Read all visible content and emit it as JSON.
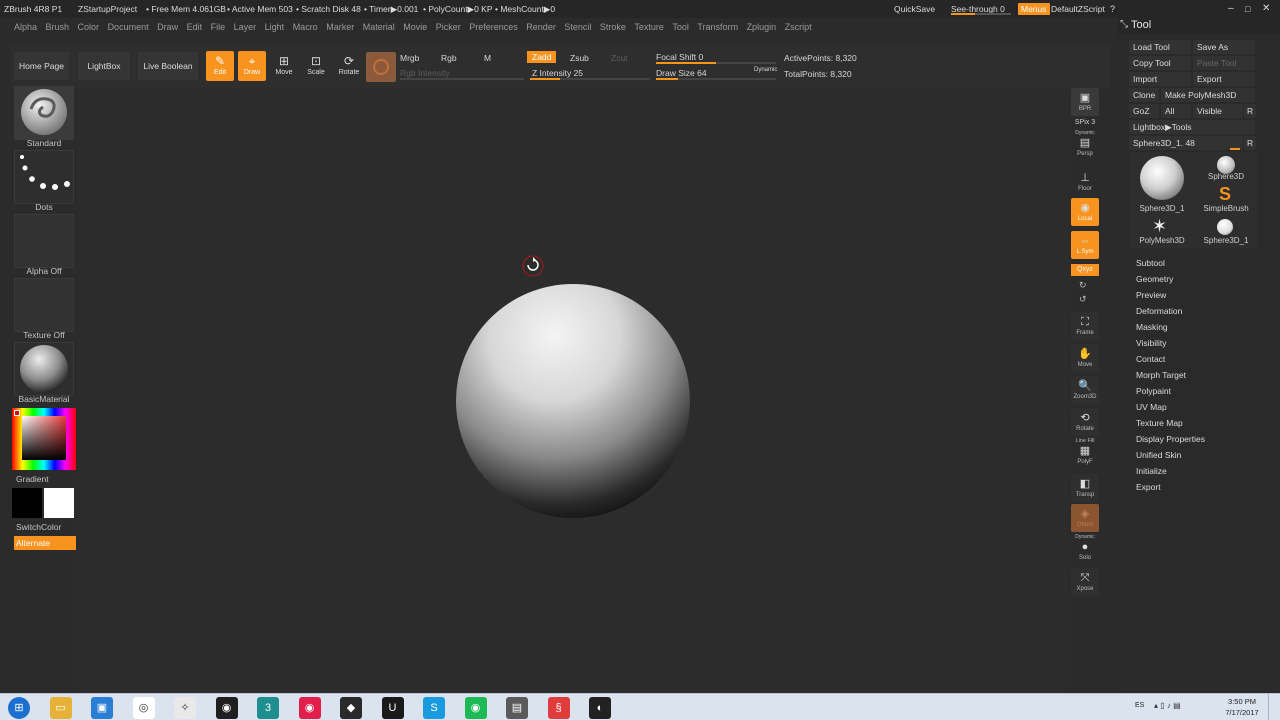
{
  "titlebar": {
    "app": "ZBrush 4R8 P1",
    "project": "ZStartupProject",
    "free_mem": "• Free Mem 4.061GB",
    "active_mem": "• Active Mem 503",
    "scratch": "• Scratch Disk 48",
    "timer": "• Timer▶0.001",
    "polycount": "• PolyCount▶0 KP",
    "meshcount": "• MeshCount▶0",
    "quicksave": "QuickSave",
    "see_through": "See-through  0",
    "menus": "Menus",
    "default_zscript": "DefaultZScript"
  },
  "menubar": [
    "Alpha",
    "Brush",
    "Color",
    "Document",
    "Draw",
    "Edit",
    "File",
    "Layer",
    "Light",
    "Macro",
    "Marker",
    "Material",
    "Movie",
    "Picker",
    "Preferences",
    "Render",
    "Stencil",
    "Stroke",
    "Texture",
    "Tool",
    "Transform",
    "Zplugin",
    "Zscript"
  ],
  "topshelf": {
    "home": "Home Page",
    "lightbox": "LightBox",
    "live_boolean": "Live Boolean",
    "edit": "Edit",
    "draw": "Draw",
    "move": "Move",
    "scale": "Scale",
    "rotate": "Rotate",
    "mrgb": "Mrgb",
    "rgb": "Rgb",
    "m": "M",
    "zadd": "Zadd",
    "zsub": "Zsub",
    "zcut": "Zcut",
    "rgb_intensity": "Rgb Intensity",
    "z_intensity": "Z Intensity 25",
    "focal_shift": "Focal Shift 0",
    "draw_size": "Draw Size 64",
    "dynamic": "Dynamic",
    "active_points": "ActivePoints: 8,320",
    "total_points": "TotalPoints: 8,320",
    "z_intensity_level": 0.25,
    "draw_size_level": 0.18,
    "focal_shift_level": 0.5
  },
  "leftbar": {
    "brush": "Standard",
    "stroke": "Dots",
    "alpha": "Alpha Off",
    "texture": "Texture Off",
    "material": "BasicMaterial",
    "gradient": "Gradient",
    "switchcolor": "SwitchColor",
    "alternate": "Alternate"
  },
  "rightdock": {
    "bpr": "BPR",
    "spix": "SPix 3",
    "dynamic": "Dynamic",
    "persp": "Persp",
    "floor": "Floor",
    "local": "Local",
    "lsym": "L.Sym",
    "xyz": "Qxyz",
    "frame": "Frame",
    "move": "Move",
    "zoom3d": "Zoom3D",
    "rotate": "Rotate",
    "linefill": "Line Fill",
    "polyf": "PolyF",
    "transp": "Transp",
    "ghost": "Ghost",
    "dynamic2": "Dynamic",
    "solo": "Solo",
    "xpose": "Xpose"
  },
  "toolpanel": {
    "title": "Tool",
    "load_tool": "Load Tool",
    "save_as": "Save As",
    "copy_tool": "Copy Tool",
    "paste_tool": "Paste Tool",
    "import": "Import",
    "export": "Export",
    "clone": "Clone",
    "make_polymesh": "Make PolyMesh3D",
    "goz": "GoZ",
    "all": "All",
    "visible": "Visible",
    "r": "R",
    "lightbox_tools": "Lightbox▶Tools",
    "current_tool": "Sphere3D_1. 48",
    "r2": "R",
    "thumbs": [
      "Sphere3D_1",
      "Sphere3D",
      "SimpleBrush",
      "PolyMesh3D",
      "Sphere3D_1"
    ],
    "sections": [
      "Subtool",
      "Geometry",
      "Preview",
      "Deformation",
      "Masking",
      "Visibility",
      "Contact",
      "Morph Target",
      "Polypaint",
      "UV Map",
      "Texture Map",
      "Display Properties",
      "Unified Skin",
      "Initialize",
      "Export"
    ]
  },
  "taskbar": {
    "lang": "ES",
    "time": "3:50 PM",
    "date": "7/17/2017",
    "icons": [
      "start-icon",
      "explorer-icon",
      "control-panel-icon",
      "chrome-icon",
      "zbrush-icon",
      "obs-icon",
      "3dsmax-icon",
      "media-icon",
      "app-icon",
      "unreal-icon",
      "skype-icon",
      "spotify-icon",
      "sublime-icon",
      "substance-icon",
      "unity-icon"
    ]
  },
  "colors": {
    "accent": "#f7931e",
    "canvas": "#2c2c2c",
    "taskbar": "#dbe3ee"
  }
}
